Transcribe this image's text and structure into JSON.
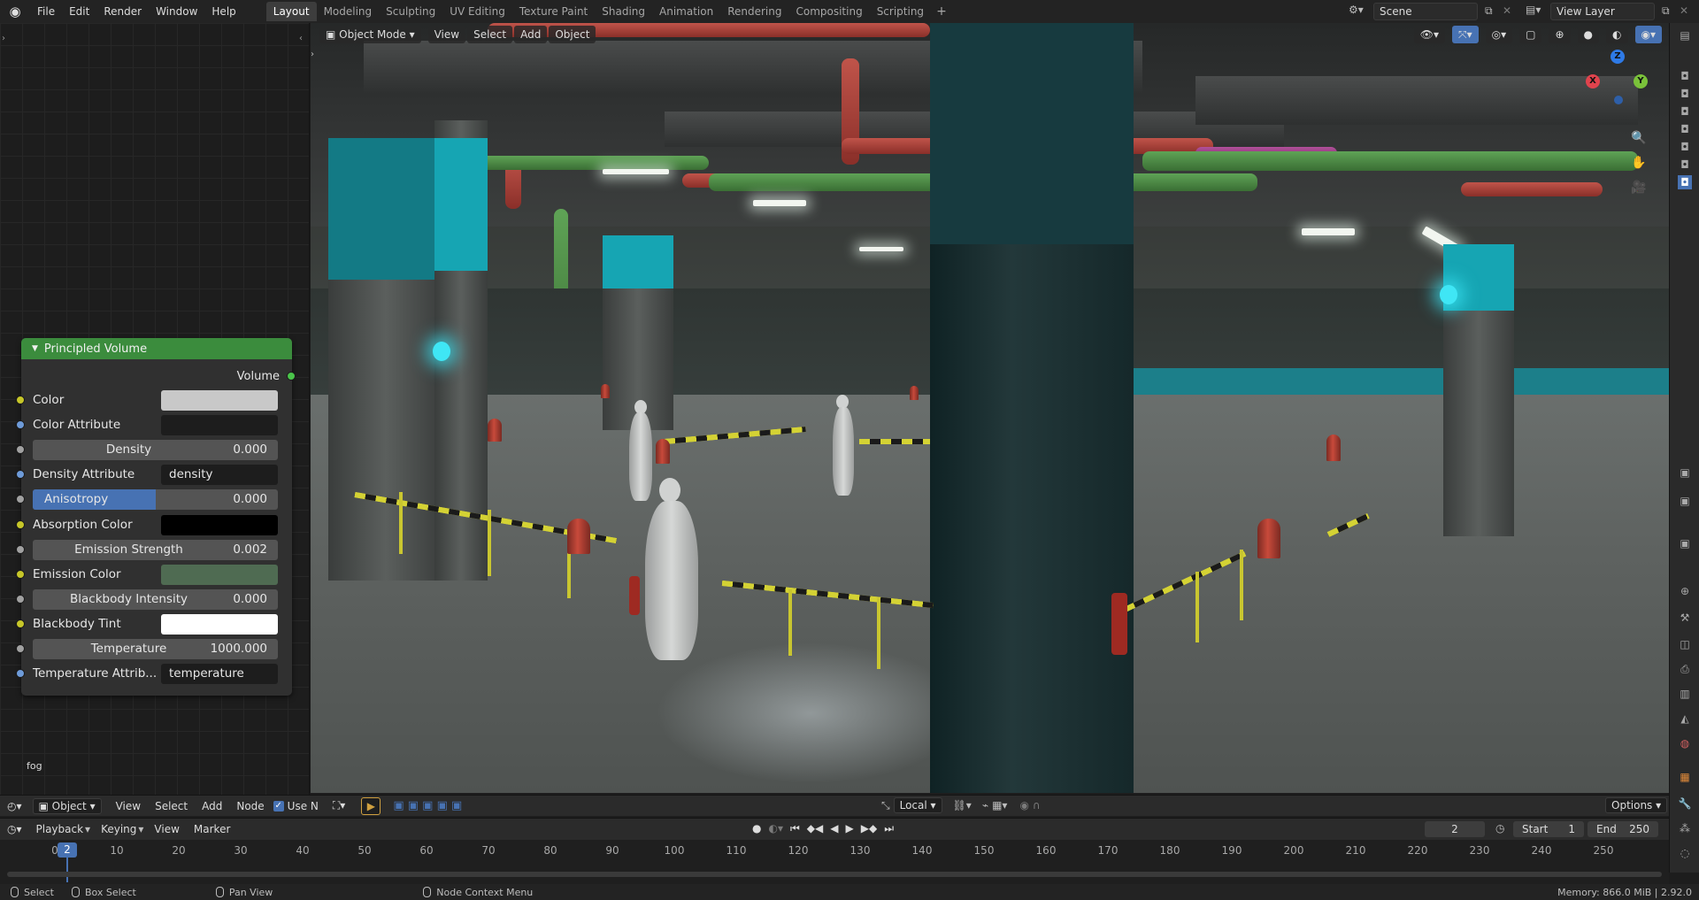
{
  "topbar": {
    "menus": [
      "File",
      "Edit",
      "Render",
      "Window",
      "Help"
    ],
    "workspaces": [
      "Layout",
      "Modeling",
      "Sculpting",
      "UV Editing",
      "Texture Paint",
      "Shading",
      "Animation",
      "Rendering",
      "Compositing",
      "Scripting"
    ],
    "active_workspace": "Layout",
    "add_tab": "+",
    "scene": "Scene",
    "view_layer": "View Layer"
  },
  "viewport": {
    "mode": "Object Mode",
    "menus": [
      "View",
      "Select",
      "Add",
      "Object"
    ],
    "gizmo": {
      "x": "X",
      "y": "Y",
      "z": "Z"
    }
  },
  "node": {
    "title": "Principled Volume",
    "output": "Volume",
    "inputs": [
      {
        "label": "Color",
        "kind": "color",
        "swatch": "#c8c8c8",
        "socket": "#c7c729"
      },
      {
        "label": "Color Attribute",
        "kind": "text",
        "value": "",
        "socket": "#6e9bd9"
      },
      {
        "label": "Density",
        "kind": "number",
        "value": "0.000",
        "socket": "#a1a1a1"
      },
      {
        "label": "Density Attribute",
        "kind": "text",
        "value": "density",
        "socket": "#6e9bd9"
      },
      {
        "label": "Anisotropy",
        "kind": "number",
        "value": "0.000",
        "fill": 0.5,
        "socket": "#a1a1a1"
      },
      {
        "label": "Absorption Color",
        "kind": "color",
        "swatch": "#000000",
        "socket": "#c7c729"
      },
      {
        "label": "Emission Strength",
        "kind": "number",
        "value": "0.002",
        "socket": "#a1a1a1"
      },
      {
        "label": "Emission Color",
        "kind": "color",
        "swatch": "#4f6b52",
        "socket": "#c7c729"
      },
      {
        "label": "Blackbody Intensity",
        "kind": "number",
        "value": "0.000",
        "socket": "#a1a1a1"
      },
      {
        "label": "Blackbody Tint",
        "kind": "color",
        "swatch": "#ffffff",
        "socket": "#c7c729"
      },
      {
        "label": "Temperature",
        "kind": "number",
        "value": "1000.000",
        "socket": "#a1a1a1"
      },
      {
        "label": "Temperature Attrib...",
        "kind": "text",
        "value": "temperature",
        "socket": "#6e9bd9"
      }
    ],
    "material_name": "fog"
  },
  "node_editor_header": {
    "editor_type": "Object",
    "menus": [
      "View",
      "Select",
      "Add",
      "Node"
    ],
    "use_nodes_label": "Use N",
    "pivot": "Local",
    "options": "Options"
  },
  "timeline": {
    "menus": [
      "Playback",
      "Keying",
      "View",
      "Marker"
    ],
    "current_frame": "2",
    "start_label": "Start",
    "start": "1",
    "end_label": "End",
    "end": "250",
    "ticks": [
      "0",
      "10",
      "20",
      "30",
      "40",
      "50",
      "60",
      "70",
      "80",
      "90",
      "100",
      "110",
      "120",
      "130",
      "140",
      "150",
      "160",
      "170",
      "180",
      "190",
      "200",
      "210",
      "220",
      "230",
      "240",
      "250"
    ]
  },
  "statusbar": {
    "select": "Select",
    "box_select": "Box Select",
    "pan_view": "Pan View",
    "context_menu": "Node Context Menu",
    "memory": "Memory: 866.0 MiB | 2.92.0"
  },
  "colors": {
    "accent": "#4772b3",
    "node_header": "#3b8c3d"
  }
}
